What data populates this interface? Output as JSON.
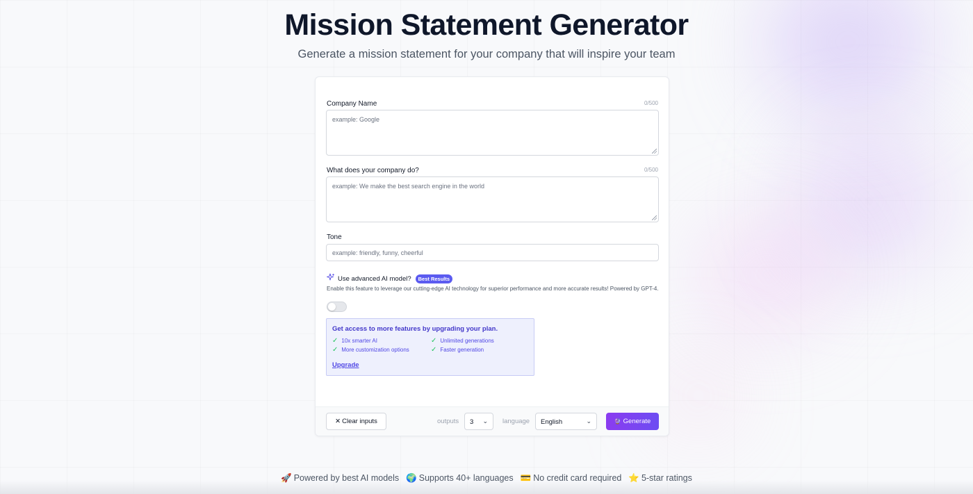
{
  "header": {
    "title": "Mission Statement Generator",
    "subtitle": "Generate a mission statement for your company that will inspire your team"
  },
  "form": {
    "company_name": {
      "label": "Company Name",
      "count": "0/500",
      "placeholder": "example: Google"
    },
    "company_does": {
      "label": "What does your company do?",
      "count": "0/500",
      "placeholder": "example: We make the best search engine in the world"
    },
    "tone": {
      "label": "Tone",
      "placeholder": "example: friendly, funny, cheerful"
    },
    "advanced": {
      "label": "Use advanced AI model?",
      "badge": "Best Results",
      "description": "Enable this feature to leverage our cutting-edge AI technology for superior performance and more accurate results! Powered by GPT-4.",
      "enabled": false
    },
    "upgrade": {
      "title": "Get access to more features by upgrading your plan.",
      "features": [
        "10x smarter AI",
        "Unlimited generations",
        "More customization options",
        "Faster generation"
      ],
      "link": "Upgrade"
    }
  },
  "footer": {
    "clear_label": "Clear inputs",
    "outputs_label": "outputs",
    "outputs_value": "3",
    "language_label": "language",
    "language_value": "English",
    "generate_label": "Generate",
    "accent": "#7c3aed"
  },
  "highlights": [
    {
      "icon": "🚀",
      "text": "Powered by best AI models"
    },
    {
      "icon": "🌍",
      "text": "Supports 40+ languages"
    },
    {
      "icon": "💳",
      "text": "No credit card required"
    },
    {
      "icon": "⭐",
      "text": "5-star ratings"
    }
  ]
}
